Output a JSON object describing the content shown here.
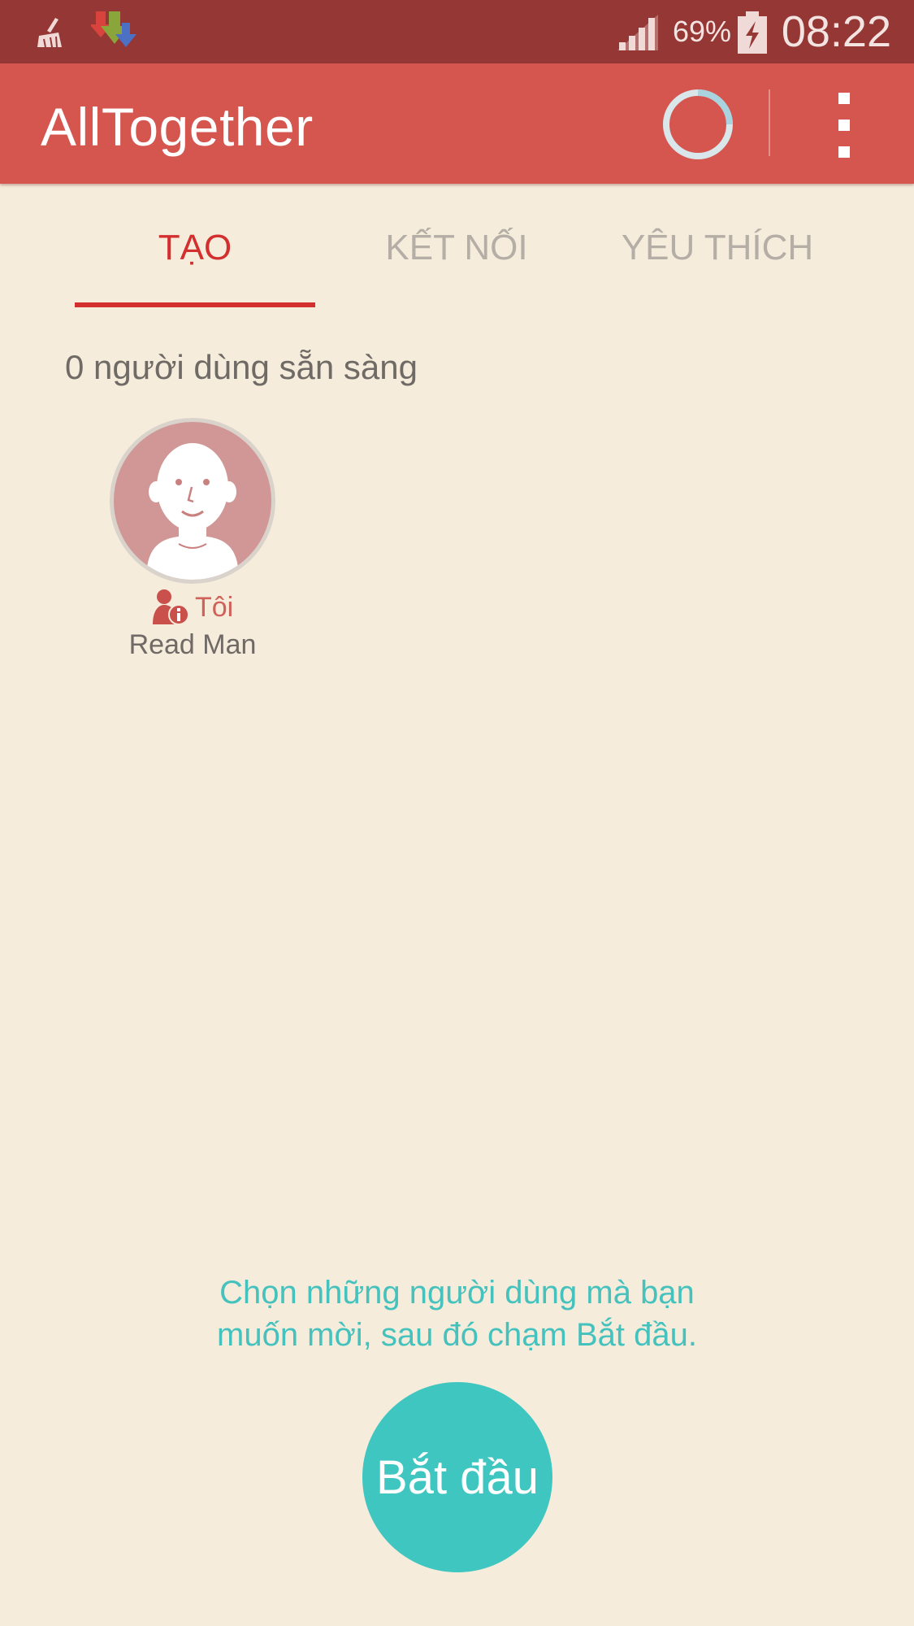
{
  "status_bar": {
    "battery_percent": "69%",
    "time": "08:22",
    "icons": [
      "cleaner-icon",
      "download-icon",
      "signal-icon",
      "battery-charging-icon"
    ]
  },
  "app_bar": {
    "title": "AllTogether",
    "icons": [
      "sync-progress-icon",
      "overflow-menu-icon"
    ],
    "color": "#d5554f"
  },
  "tabs": [
    {
      "label": "TẠO",
      "selected": true
    },
    {
      "label": "KẾT NỐI",
      "selected": false
    },
    {
      "label": "YÊU THÍCH",
      "selected": false
    }
  ],
  "main": {
    "ready_count_text": "0 người dùng sẵn sàng",
    "users": [
      {
        "tag": "Tôi",
        "name": "Read Man"
      }
    ],
    "hint_lines": [
      "Chọn những người dùng mà bạn",
      "muốn mời, sau đó chạm Bắt đầu."
    ],
    "start_label": "Bắt đầu"
  },
  "colors": {
    "background": "#f5ecdb",
    "accent": "#d32f2f",
    "teal": "#3fc6c1"
  }
}
